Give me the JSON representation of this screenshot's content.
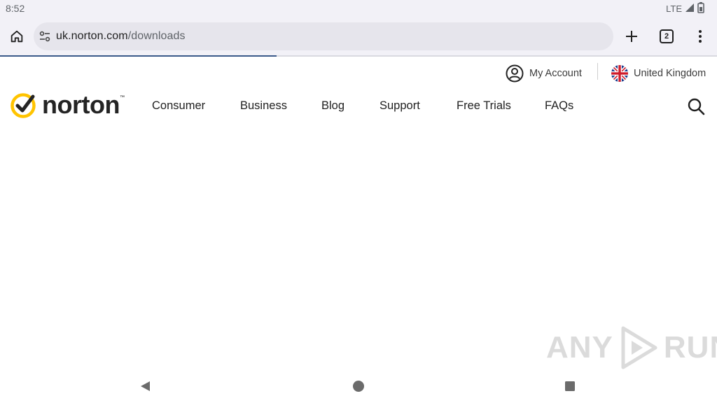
{
  "status_bar": {
    "time": "8:52",
    "network": "LTE",
    "icons": [
      "signal-icon",
      "battery-icon"
    ]
  },
  "browser": {
    "url_host": "uk.norton.com",
    "url_path": "/downloads",
    "tab_count": "2",
    "load_progress": 0.386,
    "icons": [
      "home-icon",
      "site-info-icon",
      "plus-icon",
      "tab-switcher-icon",
      "more-vert-icon"
    ]
  },
  "site": {
    "util": {
      "account_label": "My Account",
      "country_label": "United Kingdom"
    },
    "logo_text": "norton",
    "logo_tm": "™",
    "nav": [
      {
        "label": "Consumer"
      },
      {
        "label": "Business"
      },
      {
        "label": "Blog"
      },
      {
        "label": "Support"
      },
      {
        "label": "Free Trials"
      },
      {
        "label": "FAQs"
      }
    ]
  },
  "watermark": {
    "text_left": "ANY",
    "text_right": "RUN"
  },
  "colors": {
    "brand_yellow": "#FFC400",
    "progress": "#3b5a8a",
    "chrome_bg": "#f2f1f7"
  }
}
